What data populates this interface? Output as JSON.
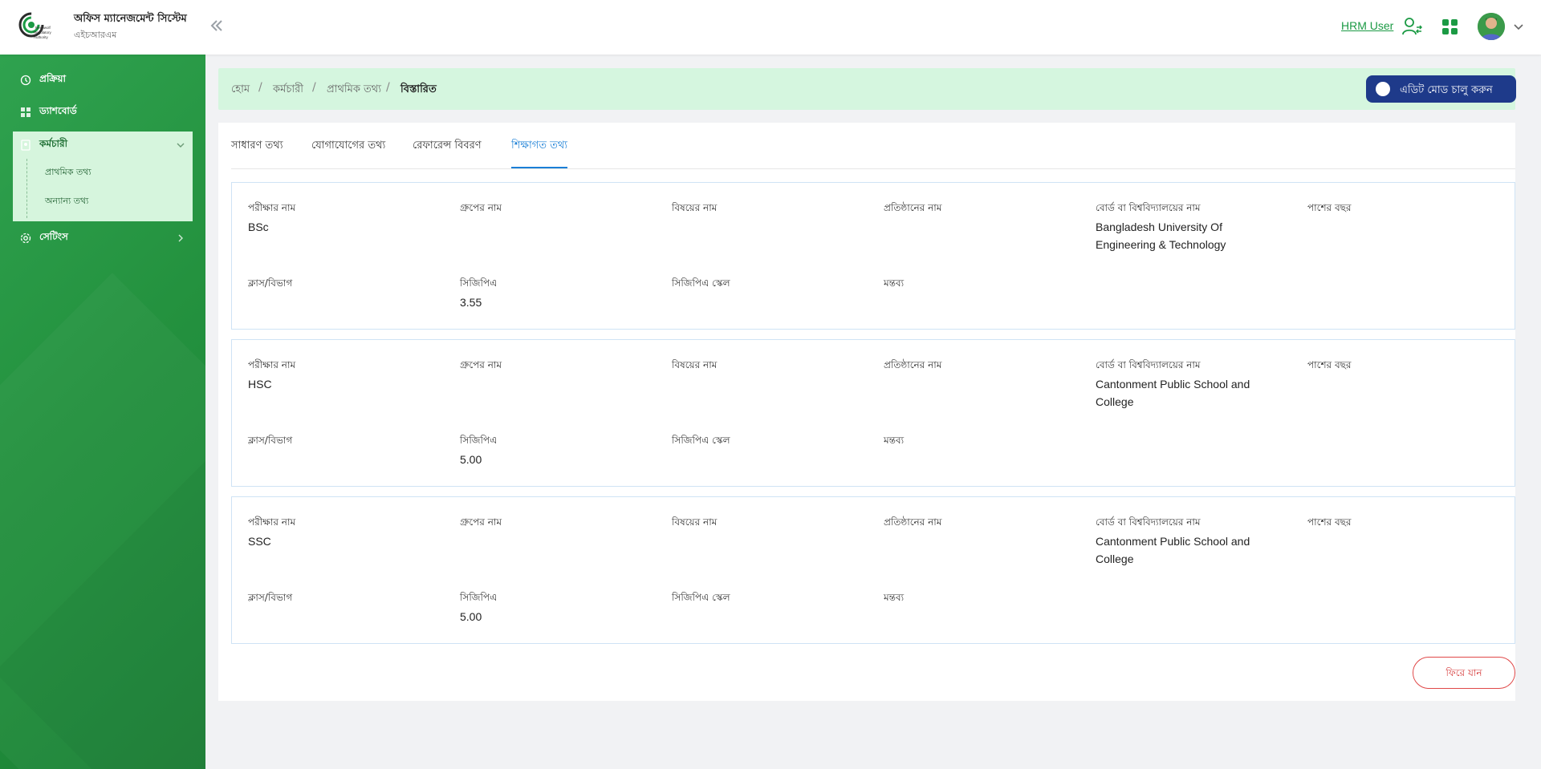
{
  "header": {
    "app_title": "অফিস ম্যানেজমেন্ট সিস্টেম",
    "app_subtitle": "এইচআরএম",
    "logo_lines": [
      "Reenwolf",
      "Regulatory",
      "Authority"
    ],
    "collapse_icon": "double-chevron-left-icon",
    "user_name": "HRM User",
    "user_icon": "user-switch-icon",
    "apps_icon": "grid-apps-icon",
    "accent_color": "#1b9a44"
  },
  "sidebar": {
    "items": [
      {
        "label": "প্রক্রিয়া",
        "icon": "process-icon"
      },
      {
        "label": "ড্যাশবোর্ড",
        "icon": "dashboard-icon"
      },
      {
        "label": "কর্মচারী",
        "icon": "employee-icon",
        "expanded": true,
        "children": [
          {
            "label": "প্রাথমিক তথ্য"
          },
          {
            "label": "অন্যান্য তথ্য"
          }
        ]
      },
      {
        "label": "সেটিংস",
        "icon": "settings-icon"
      }
    ]
  },
  "breadcrumb": {
    "items": [
      "হোম",
      "কর্মচারী",
      "প্রাথমিক তথ্য"
    ],
    "active": "বিস্তারিত",
    "separator": "/"
  },
  "edit_mode_button": {
    "label": "এডিট মোড চালু করুন",
    "color": "#1e3a8a"
  },
  "tabs": {
    "items": [
      "সাধারণ তথ্য",
      "যোগাযোগের তথ্য",
      "রেফারেন্স বিবরণ",
      "শিক্ষাগত তথ্য"
    ],
    "active_index": 3
  },
  "field_labels": {
    "exam_name": "পরীক্ষার নাম",
    "group_name": "গ্রুপের নাম",
    "subject_name": "বিষয়ের নাম",
    "institution_name": "প্রতিষ্ঠানের নাম",
    "board_university": "বোর্ড বা বিশ্ববিদ্যালয়ের নাম",
    "passing_year": "পাশের বছর",
    "class_division": "ক্লাস/বিভাগ",
    "cgpa": "সিজিপিএ",
    "cgpa_scale": "সিজিপিএ স্কেল",
    "remarks": "মন্তব্য"
  },
  "education": [
    {
      "exam_name": "BSc",
      "group_name": "",
      "subject_name": "",
      "institution_name": "",
      "board_university": "Bangladesh University Of Engineering & Technology",
      "passing_year": "",
      "class_division": "",
      "cgpa": "3.55",
      "cgpa_scale": "",
      "remarks": ""
    },
    {
      "exam_name": "HSC",
      "group_name": "",
      "subject_name": "",
      "institution_name": "",
      "board_university": "Cantonment Public School and College",
      "passing_year": "",
      "class_division": "",
      "cgpa": "5.00",
      "cgpa_scale": "",
      "remarks": ""
    },
    {
      "exam_name": "SSC",
      "group_name": "",
      "subject_name": "",
      "institution_name": "",
      "board_university": "Cantonment Public School and College",
      "passing_year": "",
      "class_division": "",
      "cgpa": "5.00",
      "cgpa_scale": "",
      "remarks": ""
    }
  ],
  "back_button": {
    "label": "ফিরে যান",
    "color": "#d63b3b"
  }
}
